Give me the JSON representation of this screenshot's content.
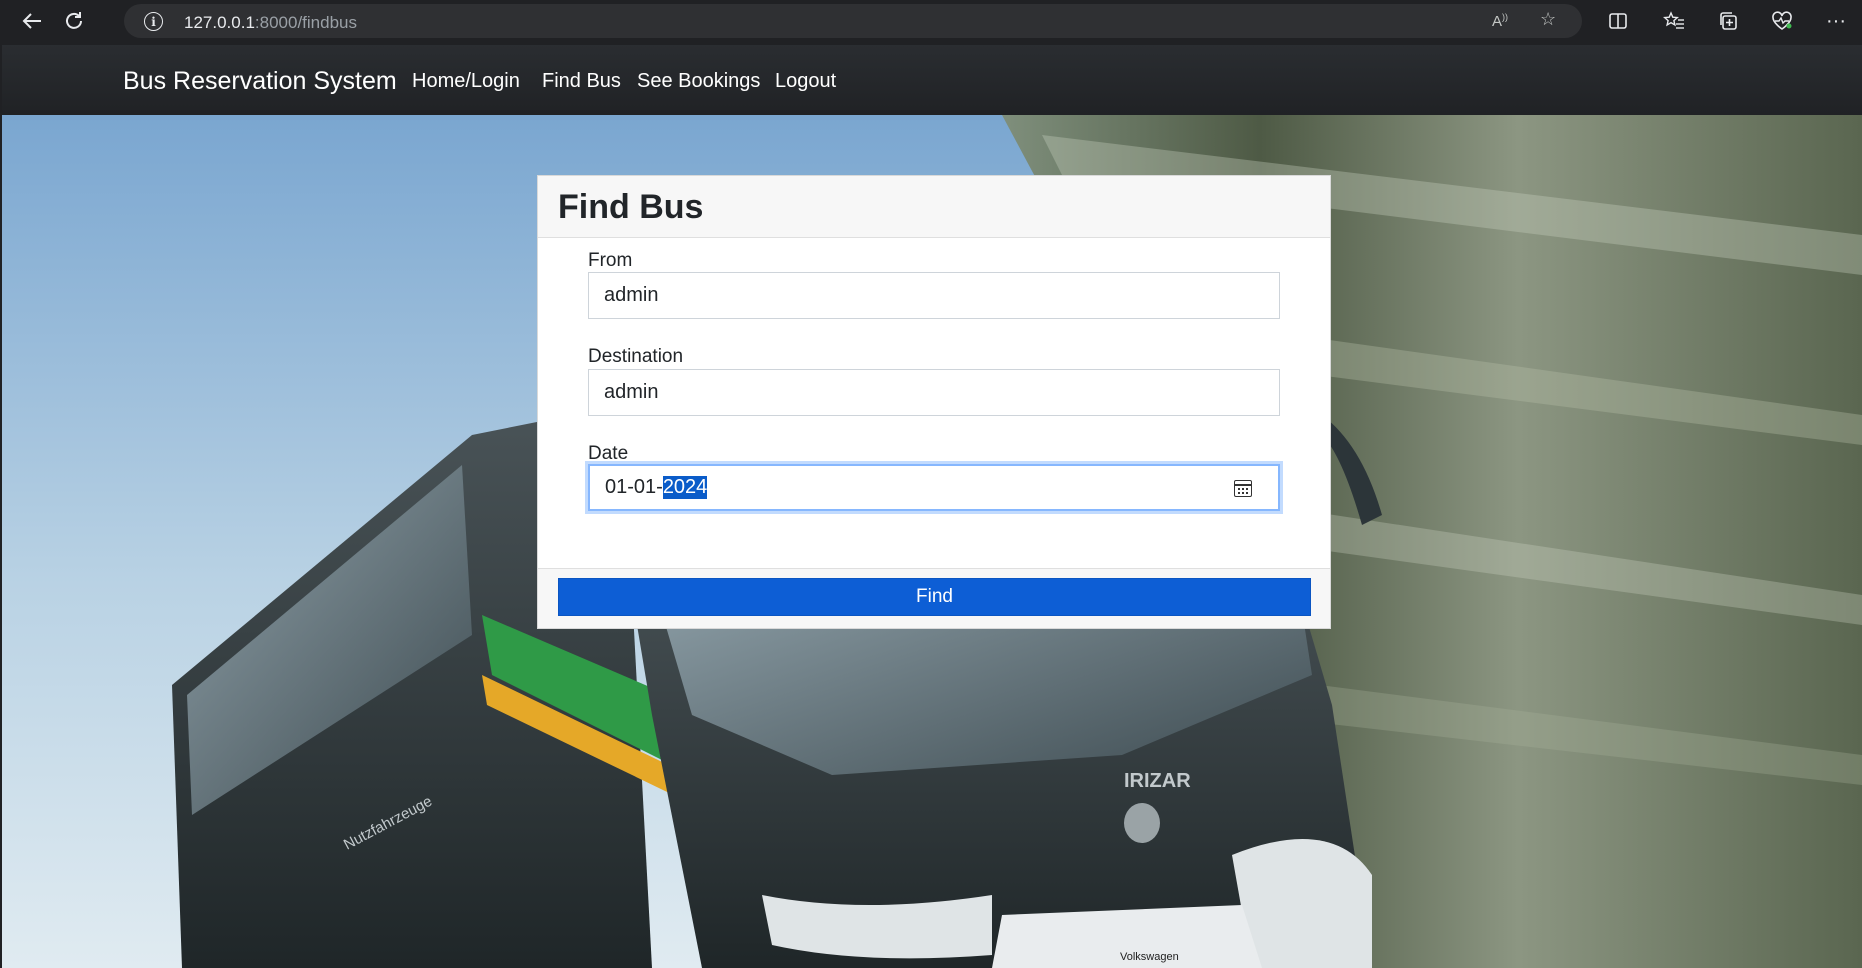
{
  "browser": {
    "url_host": "127.0.0.1",
    "url_path": ":8000/findbus",
    "icons": [
      "back-arrow-icon",
      "reload-icon",
      "site-info-icon",
      "read-aloud-icon",
      "favorite-star-icon",
      "split-screen-icon",
      "favorites-icon",
      "collections-icon",
      "browser-essentials-icon",
      "more-menu-icon"
    ]
  },
  "navbar": {
    "brand": "Bus Reservation System",
    "links": [
      "Home/Login",
      "Find Bus",
      "See Bookings",
      "Logout"
    ]
  },
  "form": {
    "title": "Find Bus",
    "from_label": "From",
    "from_value": "admin",
    "destination_label": "Destination",
    "destination_value": "admin",
    "date_label": "Date",
    "date_prefix": "01-01-",
    "date_year_selected": "2024",
    "submit_label": "Find"
  },
  "background": {
    "bus_badge": "IRIZAR",
    "side_text": "Nutzfahrzeuge",
    "plate_text": "Volkswagen"
  }
}
